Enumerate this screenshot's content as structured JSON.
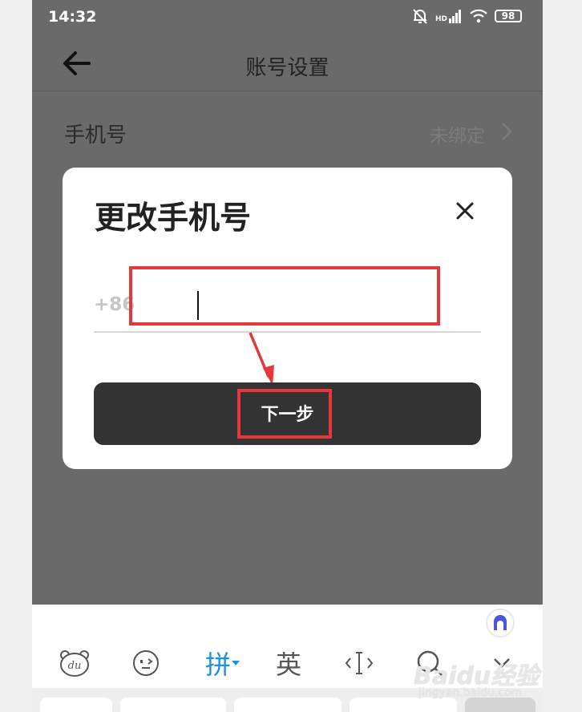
{
  "status_bar": {
    "time": "14:32",
    "network_badge": "HD",
    "battery": "98"
  },
  "header": {
    "title": "账号设置"
  },
  "settings": {
    "phone_label": "手机号",
    "phone_value": "未绑定"
  },
  "dialog": {
    "title": "更改手机号",
    "country_code": "+86",
    "phone_input_value": "",
    "next_button_label": "下一步"
  },
  "keyboard": {
    "pinyin_label": "拼",
    "english_label": "英"
  },
  "watermark": {
    "brand": "Baidu经验",
    "url": "jingyan.baidu.com"
  },
  "colors": {
    "overlay": "#6a6a6a",
    "dialog_bg": "#ffffff",
    "button_bg": "#333333",
    "annotation_red": "#e5383b",
    "keyboard_accent": "#1a8fe3"
  }
}
